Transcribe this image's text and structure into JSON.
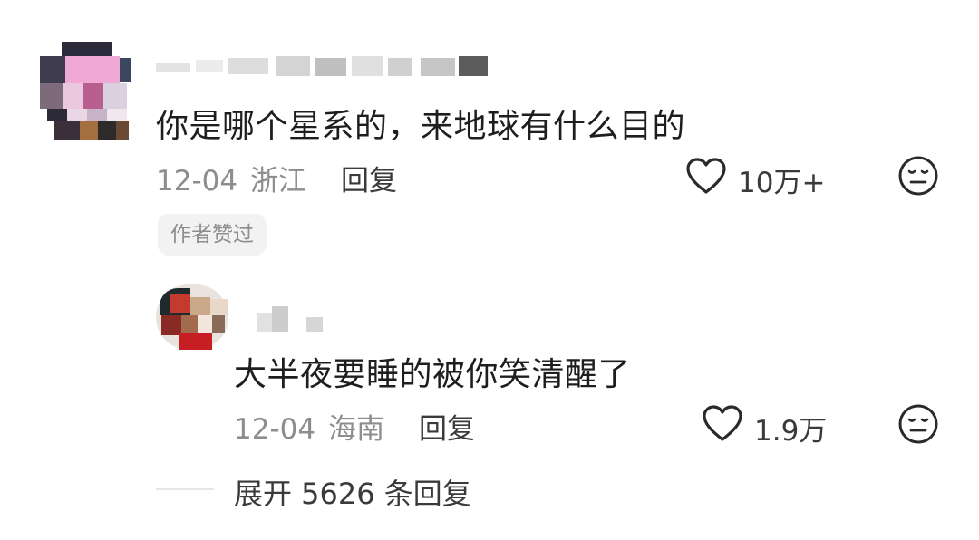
{
  "comment": {
    "text": "你是哪个星系的，来地球有什么目的",
    "date": "12-04",
    "location": "浙江",
    "reply_label": "回复",
    "likes": "10万+",
    "badge": "作者赞过"
  },
  "reply": {
    "text": "大半夜要睡的被你笑清醒了",
    "date": "12-04",
    "location": "海南",
    "reply_label": "回复",
    "likes": "1.9万"
  },
  "expand": {
    "label": "展开 5626 条回复"
  }
}
